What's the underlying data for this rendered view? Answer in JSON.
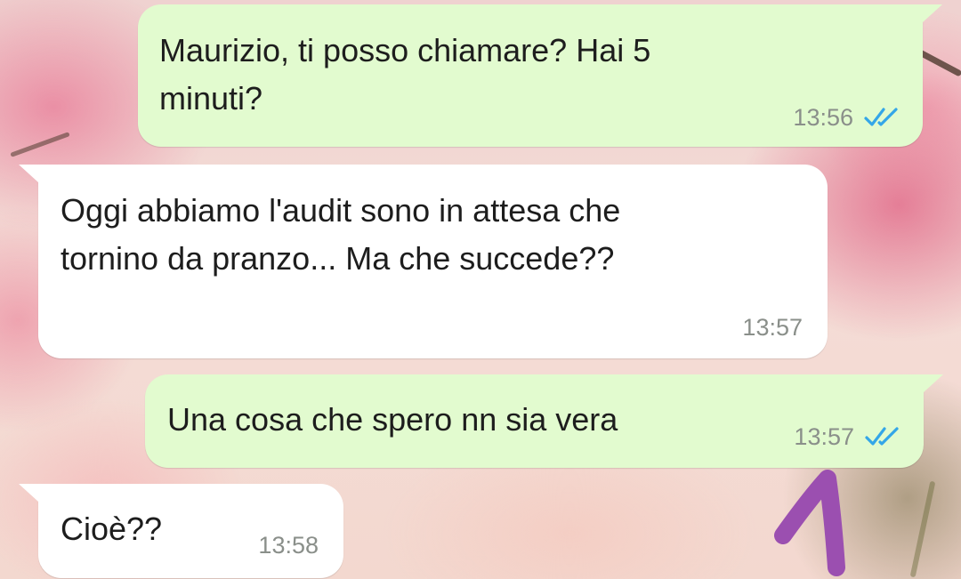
{
  "messages": [
    {
      "direction": "outgoing",
      "text": "Maurizio, ti posso chiamare? Hai 5\nminuti?",
      "time": "13:56",
      "status": "read",
      "status_icon": "double-check-icon"
    },
    {
      "direction": "incoming",
      "text": "Oggi abbiamo l'audit sono in attesa che\ntornino da pranzo... Ma che succede??",
      "time": "13:57"
    },
    {
      "direction": "outgoing",
      "text": "Una cosa che spero nn sia vera",
      "time": "13:57",
      "status": "read",
      "status_icon": "double-check-icon"
    },
    {
      "direction": "incoming",
      "text": "Cioè??",
      "time": "13:58"
    }
  ],
  "colors": {
    "outgoing_bubble": "#e2fbcf",
    "incoming_bubble": "#ffffff",
    "read_ticks": "#34a6e8",
    "timestamp": "#8a8f8a",
    "annotation": "#9b4fb0"
  },
  "annotation": {
    "icon": "handwritten-one-mark",
    "number": 1
  }
}
